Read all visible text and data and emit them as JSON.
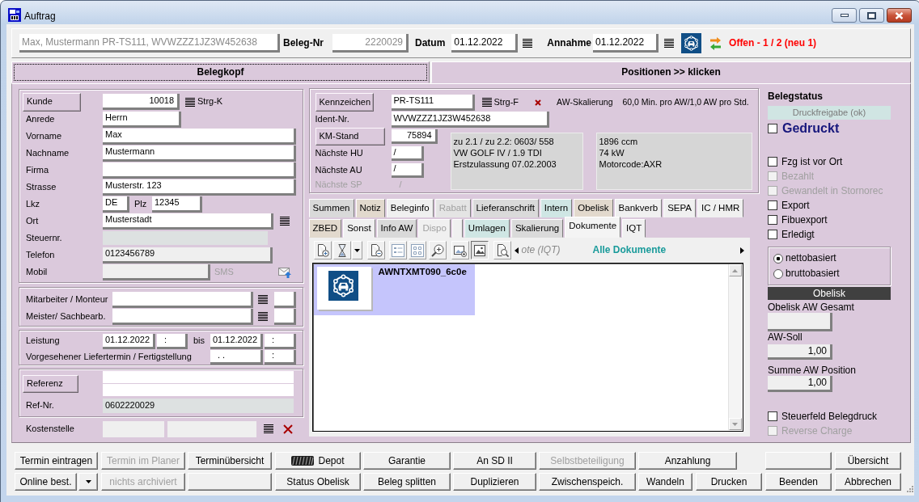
{
  "window": {
    "title": "Auftrag"
  },
  "header": {
    "summary": {
      "value": "Max, Mustermann PR-TS111, WVWZZZ1JZ3W452638",
      "disabled": true
    },
    "beleg_nr_label": "Beleg-Nr",
    "beleg_nr": {
      "value": "2220029",
      "disabled": true
    },
    "datum_label": "Datum",
    "datum": {
      "value": "01.12.2022",
      "disabled": false
    },
    "annahme_label": "Annahme",
    "annahme": {
      "value": "01.12.2022",
      "disabled": false
    },
    "status": "Offen - 1 / 2 (neu 1)"
  },
  "page_tabs": [
    {
      "label": "Belegkopf",
      "selected": true
    },
    {
      "label": "Positionen >> klicken",
      "selected": false
    }
  ],
  "customer": {
    "kunde_button": "Kunde",
    "kunde": "10018",
    "kunde_shortcut": "Strg-K",
    "anrede": {
      "label": "Anrede",
      "value": "Herrn"
    },
    "vorname": {
      "label": "Vorname",
      "value": "Max"
    },
    "nachname": {
      "label": "Nachname",
      "value": "Mustermann"
    },
    "firma": {
      "label": "Firma"
    },
    "strasse": {
      "label": "Strasse",
      "value": "Musterstr. 123"
    },
    "lkz": {
      "label": "Lkz",
      "value": "DE"
    },
    "plz": {
      "label": "Plz",
      "value": "12345"
    },
    "ort": {
      "label": "Ort",
      "value": "Musterstadt"
    },
    "steuernr": {
      "label": "Steuernr."
    },
    "telefon": {
      "label": "Telefon",
      "value": "0123456789",
      "readonly": true
    },
    "mobil": {
      "label": "Mobil",
      "readonly": true
    },
    "sms": {
      "label": "SMS",
      "disabled": true
    }
  },
  "staff": [
    {
      "label": "Mitarbeiter / Monteur"
    },
    {
      "label": "Meister/ Sachbearb."
    }
  ],
  "schedule": {
    "leistung_label": "Leistung",
    "von_datum": "01.12.2022",
    "von_zeit": ":",
    "bis_label": "bis",
    "bis_datum": "01.12.2022",
    "bis_zeit": ":",
    "liefer_label": "Vorgesehener Liefertermin / Fertigstellung",
    "liefer_datum": ". .",
    "liefer_zeit": ":"
  },
  "reference": {
    "button": "Referenz",
    "ref_nr_label": "Ref-Nr.",
    "ref_nr": "0602220029"
  },
  "cost_center": {
    "label": "Kostenstelle",
    "fields": [
      {
        "readonly": true
      },
      {
        "readonly": true
      }
    ]
  },
  "vehicle": {
    "kennzeichen_button": "Kennzeichen",
    "kennzeichen": "PR-TS111",
    "shortcut": "Strg-F",
    "aw_label": "AW-Skalierung",
    "aw_value": "60,0 Min. pro AW/1,0 AW pro Std.",
    "ident_label": "Ident-Nr.",
    "ident": "WVWZZZ1JZ3W452638",
    "km_button": "KM-Stand",
    "km": "75894",
    "inspections": [
      {
        "label": "Nächste HU",
        "value": "/",
        "disabled": false
      },
      {
        "label": "Nächste AU",
        "value": "/",
        "disabled": false
      },
      {
        "label": "Nächste SP",
        "value": "/",
        "disabled": true
      }
    ],
    "details_1": [
      "zu 2.1 / zu 2.2: 0603/ 558",
      "VW GOLF IV / 1.9 TDI",
      "Erstzulassung 07.02.2003"
    ],
    "details_2": [
      "1896 ccm",
      "74 kW",
      "Motorcode:AXR"
    ]
  },
  "tabs_row_1": [
    {
      "label": "Summen",
      "selected": false,
      "disabled": false,
      "color": "#d9d9d9"
    },
    {
      "label": "Notiz",
      "selected": false,
      "disabled": false,
      "color": "#e2d9cd"
    },
    {
      "label": "Beleginfo",
      "selected": false,
      "disabled": false,
      "color": "#f0f0f0"
    },
    {
      "label": "Rabatt",
      "selected": false,
      "disabled": true,
      "color": "#e4e4e4"
    },
    {
      "label": "Lieferanschrift",
      "selected": false,
      "disabled": false,
      "color": "#dadada"
    },
    {
      "label": "Intern",
      "selected": false,
      "disabled": false,
      "color": "#cfe6e4"
    },
    {
      "label": "Obelisk",
      "selected": false,
      "disabled": false,
      "color": "#e2d9cd"
    },
    {
      "label": "Bankverb",
      "selected": false,
      "disabled": false,
      "color": "#f0f0f0"
    },
    {
      "label": "SEPA",
      "selected": false,
      "disabled": false,
      "color": "#f0f0f0"
    },
    {
      "label": "IC / HMR",
      "selected": false,
      "disabled": false,
      "color": "#f0f0f0"
    }
  ],
  "tabs_row_2": [
    {
      "label": "ZBED",
      "selected": false,
      "disabled": false,
      "color": "#e2d9cd"
    },
    {
      "label": "Sonst",
      "selected": false,
      "disabled": false,
      "color": "#f0f0f0"
    },
    {
      "label": "Info AW",
      "selected": false,
      "disabled": false,
      "color": "#d9d9d9"
    },
    {
      "label": "Dispo",
      "selected": false,
      "disabled": true,
      "color": "#f0f0f0"
    },
    {
      "selected": false,
      "color": "#f0f0f0"
    },
    {
      "label": "Umlagen",
      "selected": false,
      "disabled": false,
      "color": "#cfe6e4"
    },
    {
      "label": "Skalierung",
      "selected": false,
      "disabled": false,
      "color": "#dadada"
    },
    {
      "label": "Dokumente",
      "selected": true,
      "disabled": false,
      "color": "#f4f4f4"
    },
    {
      "label": "IQT",
      "selected": false,
      "disabled": false,
      "color": "#f0f0f0"
    }
  ],
  "documents": {
    "toolbar": [
      {
        "kind": "add",
        "pressed": false
      },
      {
        "kind": "filter",
        "pressed": false
      },
      {
        "kind": "remove",
        "pressed": false
      },
      {
        "kind": "list-view",
        "pressed": false
      },
      {
        "kind": "grid-view",
        "pressed": false
      },
      {
        "kind": "zoom",
        "pressed": false
      },
      {
        "kind": "image-add",
        "pressed": false
      },
      {
        "kind": "image-view",
        "pressed": true
      },
      {
        "kind": "find",
        "pressed": false
      }
    ],
    "doc_tabs": [
      {
        "label": "ote (IQT)",
        "selected": false
      },
      {
        "label": "Alle Dokumente",
        "selected": true
      }
    ],
    "items": [
      {
        "name": "AWNTXMT090_6c0e",
        "selected": true
      }
    ]
  },
  "status": {
    "title": "Belegstatus",
    "release": "Druckfreigabe (ok)",
    "printed": {
      "label": "Gedruckt",
      "checked": false
    },
    "checks": [
      {
        "label": "Fzg ist vor Ort",
        "checked": false,
        "disabled": false
      },
      {
        "label": "Bezahlt",
        "checked": false,
        "disabled": true
      },
      {
        "label": "Gewandelt in Stornorec",
        "checked": false,
        "disabled": true
      },
      {
        "label": "Export",
        "checked": false,
        "disabled": false
      },
      {
        "label": "Fibuexport",
        "checked": false,
        "disabled": false
      },
      {
        "label": "Erledigt",
        "checked": false,
        "disabled": false
      }
    ],
    "basis": [
      {
        "label": "nettobasiert",
        "selected": true
      },
      {
        "label": "bruttobasiert",
        "selected": false
      }
    ],
    "obelisk_title": "Obelisk",
    "obelisk_fields": [
      {
        "label": "Obelisk AW Gesamt",
        "readonly": true
      },
      {
        "label": "AW-Soll",
        "value": "1,00",
        "readonly": true
      },
      {
        "label": "Summe AW Position",
        "value": "1,00",
        "readonly": true
      }
    ],
    "extra_checks": [
      {
        "label": "Steuerfeld Belegdruck",
        "checked": false,
        "disabled": false
      },
      {
        "label": "Reverse Charge",
        "checked": false,
        "disabled": true
      }
    ]
  },
  "buttons": [
    [
      {
        "kind": "text",
        "label": "Termin eintragen",
        "disabled": false
      },
      {
        "kind": "text",
        "label": "Termin im Planer",
        "disabled": true
      },
      {
        "kind": "text",
        "label": "Terminübersicht",
        "disabled": false
      },
      {
        "kind": "icon-text",
        "label": "Depot",
        "disabled": false
      },
      {
        "kind": "text",
        "label": "Garantie",
        "disabled": false
      },
      {
        "kind": "text",
        "label": "An SD II",
        "disabled": false
      },
      {
        "kind": "text",
        "label": "Selbstbeteiligung",
        "disabled": true
      },
      {
        "kind": "text",
        "label": "Anzahlung",
        "disabled": false
      },
      {
        "kind": "blank"
      },
      {
        "kind": "text",
        "label": "Übersicht",
        "disabled": false
      }
    ],
    [
      {
        "kind": "text",
        "label": "Online best.",
        "disabled": false
      },
      {
        "kind": "dropdown",
        "disabled": false
      },
      {
        "kind": "text",
        "label": "nichts archiviert",
        "disabled": true
      },
      {
        "kind": "blank"
      },
      {
        "kind": "text",
        "label": "Status Obelisk",
        "disabled": false
      },
      {
        "kind": "text",
        "label": "Beleg splitten",
        "disabled": false
      },
      {
        "kind": "text",
        "label": "Duplizieren",
        "disabled": false
      },
      {
        "kind": "text",
        "label": "Zwischenspeich.",
        "disabled": false
      },
      {
        "kind": "text",
        "label": "Wandeln",
        "disabled": false
      },
      {
        "kind": "text",
        "label": "Drucken",
        "disabled": false
      },
      {
        "kind": "text",
        "label": "Beenden",
        "disabled": false
      },
      {
        "kind": "text",
        "label": "Abbrechen",
        "disabled": false
      }
    ]
  ]
}
